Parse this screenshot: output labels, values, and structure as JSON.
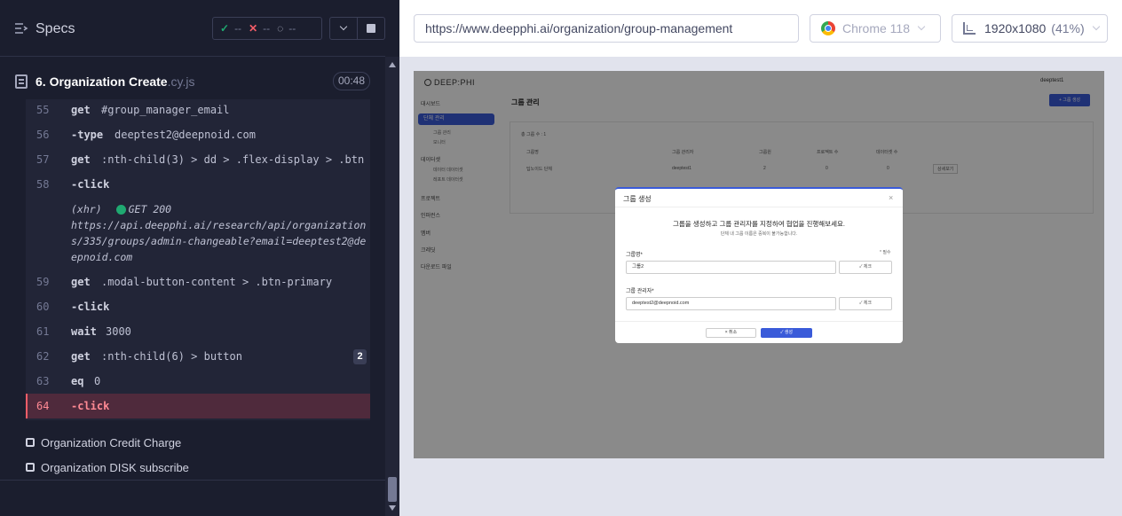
{
  "reporter": {
    "specs_label": "Specs",
    "stats": {
      "passed": "--",
      "failed": "--",
      "pending": "--"
    },
    "spec": {
      "name": "6. Organization Create",
      "ext": ".cy.js",
      "duration": "00:48"
    },
    "commands": [
      {
        "num": "55",
        "name": "get",
        "message": "#group_manager_email"
      },
      {
        "num": "56",
        "name": "-type",
        "message": "deeptest2@deepnoid.com"
      },
      {
        "num": "57",
        "name": "get",
        "message": ":nth-child(3) > dd > .flex-display > .btn"
      },
      {
        "num": "58",
        "name": "-click",
        "message": ""
      },
      {
        "num": "59",
        "name": "get",
        "message": ".modal-button-content > .btn-primary"
      },
      {
        "num": "60",
        "name": "-click",
        "message": ""
      },
      {
        "num": "61",
        "name": "wait",
        "message": "3000"
      },
      {
        "num": "62",
        "name": "get",
        "message": ":nth-child(6) > button",
        "count": "2"
      },
      {
        "num": "63",
        "name": "eq",
        "message": "0"
      },
      {
        "num": "64",
        "name": "-click",
        "message": ""
      }
    ],
    "xhr": {
      "label": "(xhr)",
      "method_status": "GET 200",
      "url": "https://api.deepphi.ai/research/api/organizations/335/groups/admin-changeable?email=deeptest2@deepnoid.com"
    },
    "other_specs": [
      "Organization Credit Charge",
      "Organization DISK subscribe"
    ]
  },
  "aut_header": {
    "url": "https://www.deepphi.ai/organization/group-management",
    "browser": "Chrome 118",
    "viewport": "1920x1080",
    "scale": "(41%)"
  },
  "app": {
    "logo": "DEEP:PHI",
    "user": "deeptest1",
    "nav": [
      "대시보드",
      "단체 관리",
      "그룹 관리",
      "모니터",
      "데이터셋",
      "데이터 데이터셋",
      "레포트 데이터셋",
      "프로젝트",
      "인퍼런스",
      "멤버",
      "크레딧",
      "다운로드 파일"
    ],
    "page_title": "그룹 관리",
    "create_button": "+ 그룹 생성",
    "table_summary": "총 그룹 수 : 1",
    "table_headers": [
      "그룹명",
      "그룹 관리자",
      "그룹원",
      "프로젝트 수",
      "데이터셋 수"
    ],
    "table_row": [
      "딥노이드 단체",
      "deeptest1",
      "2",
      "0",
      "0",
      "상세보기"
    ],
    "modal": {
      "title": "그룹 생성",
      "description": "그룹을 생성하고 그룹 관리자를 지정하여 협업을 진행해보세요.",
      "sub": "단체 내 그룹 이름은 중복이 불가능합니다.",
      "required": "* 필수",
      "group_name_label": "그룹명*",
      "group_name_value": "그룹2",
      "manager_label": "그룹 관리자*",
      "manager_value": "deeptest2@deepnoid.com",
      "check_label": "✓ 체크",
      "cancel_label": "× 취소",
      "create_label": "✓ 생성"
    }
  }
}
